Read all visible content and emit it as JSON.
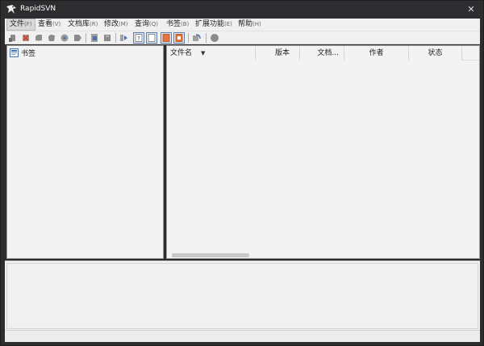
{
  "window": {
    "title": "RapidSVN"
  },
  "menu": [
    {
      "label": "文件",
      "accel": "(F)"
    },
    {
      "label": "查看",
      "accel": "(V)"
    },
    {
      "label": "文档库",
      "accel": "(R)"
    },
    {
      "label": "修改",
      "accel": "(M)"
    },
    {
      "label": "查询",
      "accel": "(Q)"
    },
    {
      "label": "书签",
      "accel": "(B)"
    },
    {
      "label": "扩展功能",
      "accel": "(E)"
    },
    {
      "label": "帮助",
      "accel": "(H)"
    }
  ],
  "toolbar": {
    "icons": [
      "checkout-icon",
      "delete-icon",
      "update-icon",
      "commit-icon",
      "refresh-icon",
      "tag-icon",
      "add-icon",
      "merge-icon",
      "log-icon",
      "info-icon",
      "blank-doc-icon",
      "flat-view-icon",
      "modified-only-icon",
      "refresh-view-icon",
      "stop-icon"
    ]
  },
  "tree": {
    "root_label": "书签"
  },
  "file_list": {
    "columns": [
      {
        "label": "文件名"
      },
      {
        "label": "版本"
      },
      {
        "label": "文档..."
      },
      {
        "label": "作者"
      },
      {
        "label": "状态"
      }
    ]
  },
  "status": {
    "text": ""
  },
  "colors": {
    "titlebar": "#2d2d30",
    "panel": "#f3f3f3",
    "accent_orange": "#e8743b",
    "accent_blue": "#4a72b0"
  }
}
